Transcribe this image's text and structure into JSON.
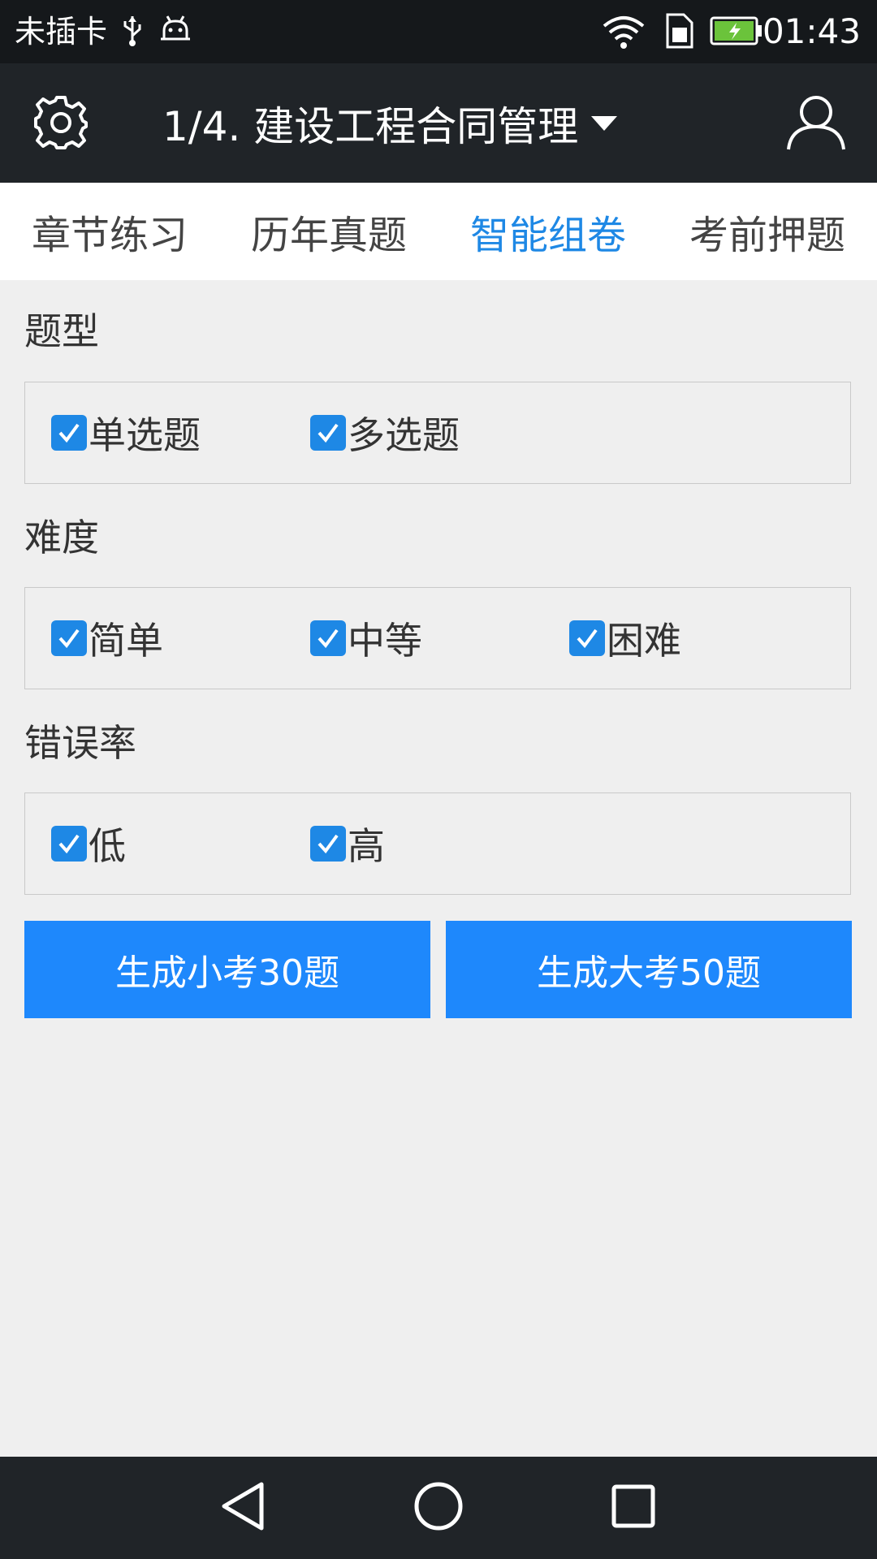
{
  "status_bar": {
    "carrier": "未插卡",
    "time": "01:43",
    "icons": [
      "usb-icon",
      "android-debug-icon",
      "wifi-icon",
      "sim-icon",
      "battery-charging-icon"
    ]
  },
  "app_bar": {
    "title": "1/4. 建设工程合同管理",
    "icons": [
      "gear-icon",
      "caret-down-icon",
      "user-icon"
    ]
  },
  "tabs": [
    {
      "label": "章节练习",
      "active": false
    },
    {
      "label": "历年真题",
      "active": false
    },
    {
      "label": "智能组卷",
      "active": true
    },
    {
      "label": "考前押题",
      "active": false
    }
  ],
  "sections": {
    "question_type": {
      "label": "题型",
      "options": [
        {
          "label": "单选题",
          "checked": true
        },
        {
          "label": "多选题",
          "checked": true
        }
      ]
    },
    "difficulty": {
      "label": "难度",
      "options": [
        {
          "label": "简单",
          "checked": true
        },
        {
          "label": "中等",
          "checked": true
        },
        {
          "label": "困难",
          "checked": true
        }
      ]
    },
    "error_rate": {
      "label": "错误率",
      "options": [
        {
          "label": "低",
          "checked": true
        },
        {
          "label": "高",
          "checked": true
        }
      ]
    }
  },
  "actions": {
    "small_exam": "生成小考30题",
    "big_exam": "生成大考50题"
  },
  "colors": {
    "accent": "#1e88e5",
    "button": "#1e88fc",
    "app_bar": "#202428",
    "background": "#efefef"
  },
  "nav_bar": {
    "icons": [
      "back-icon",
      "home-icon",
      "recents-icon"
    ]
  }
}
